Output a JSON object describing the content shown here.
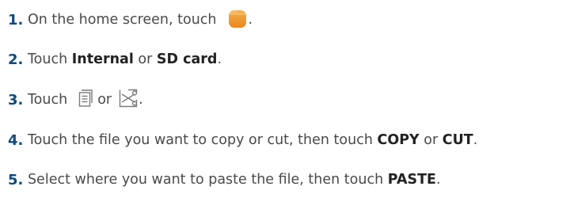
{
  "steps": [
    {
      "number": "1.",
      "parts": {
        "before": "On the home screen, touch",
        "after": "."
      },
      "icon": "files-folder-icon",
      "icon_color": "#f19a2c"
    },
    {
      "number": "2.",
      "parts": {
        "before": "Touch ",
        "bold1": "Internal",
        "middle": " or ",
        "bold2": "SD card",
        "after": "."
      }
    },
    {
      "number": "3.",
      "parts": {
        "before": "Touch",
        "middle": " or",
        "after": "."
      },
      "icons": [
        "copy-icon",
        "cut-icon"
      ]
    },
    {
      "number": "4.",
      "parts": {
        "before": "Touch the file you want to copy or cut, then touch ",
        "bold1": "COPY",
        "middle": " or ",
        "bold2": "CUT",
        "after": "."
      }
    },
    {
      "number": "5.",
      "parts": {
        "before": "Select where you want to paste the file, then touch ",
        "bold1": "PASTE",
        "after": "."
      }
    }
  ],
  "colors": {
    "step_number": "#0e4a7d",
    "text": "#4a4a4a",
    "emphasis": "#222222",
    "icon_stroke": "#7a7a7a"
  }
}
